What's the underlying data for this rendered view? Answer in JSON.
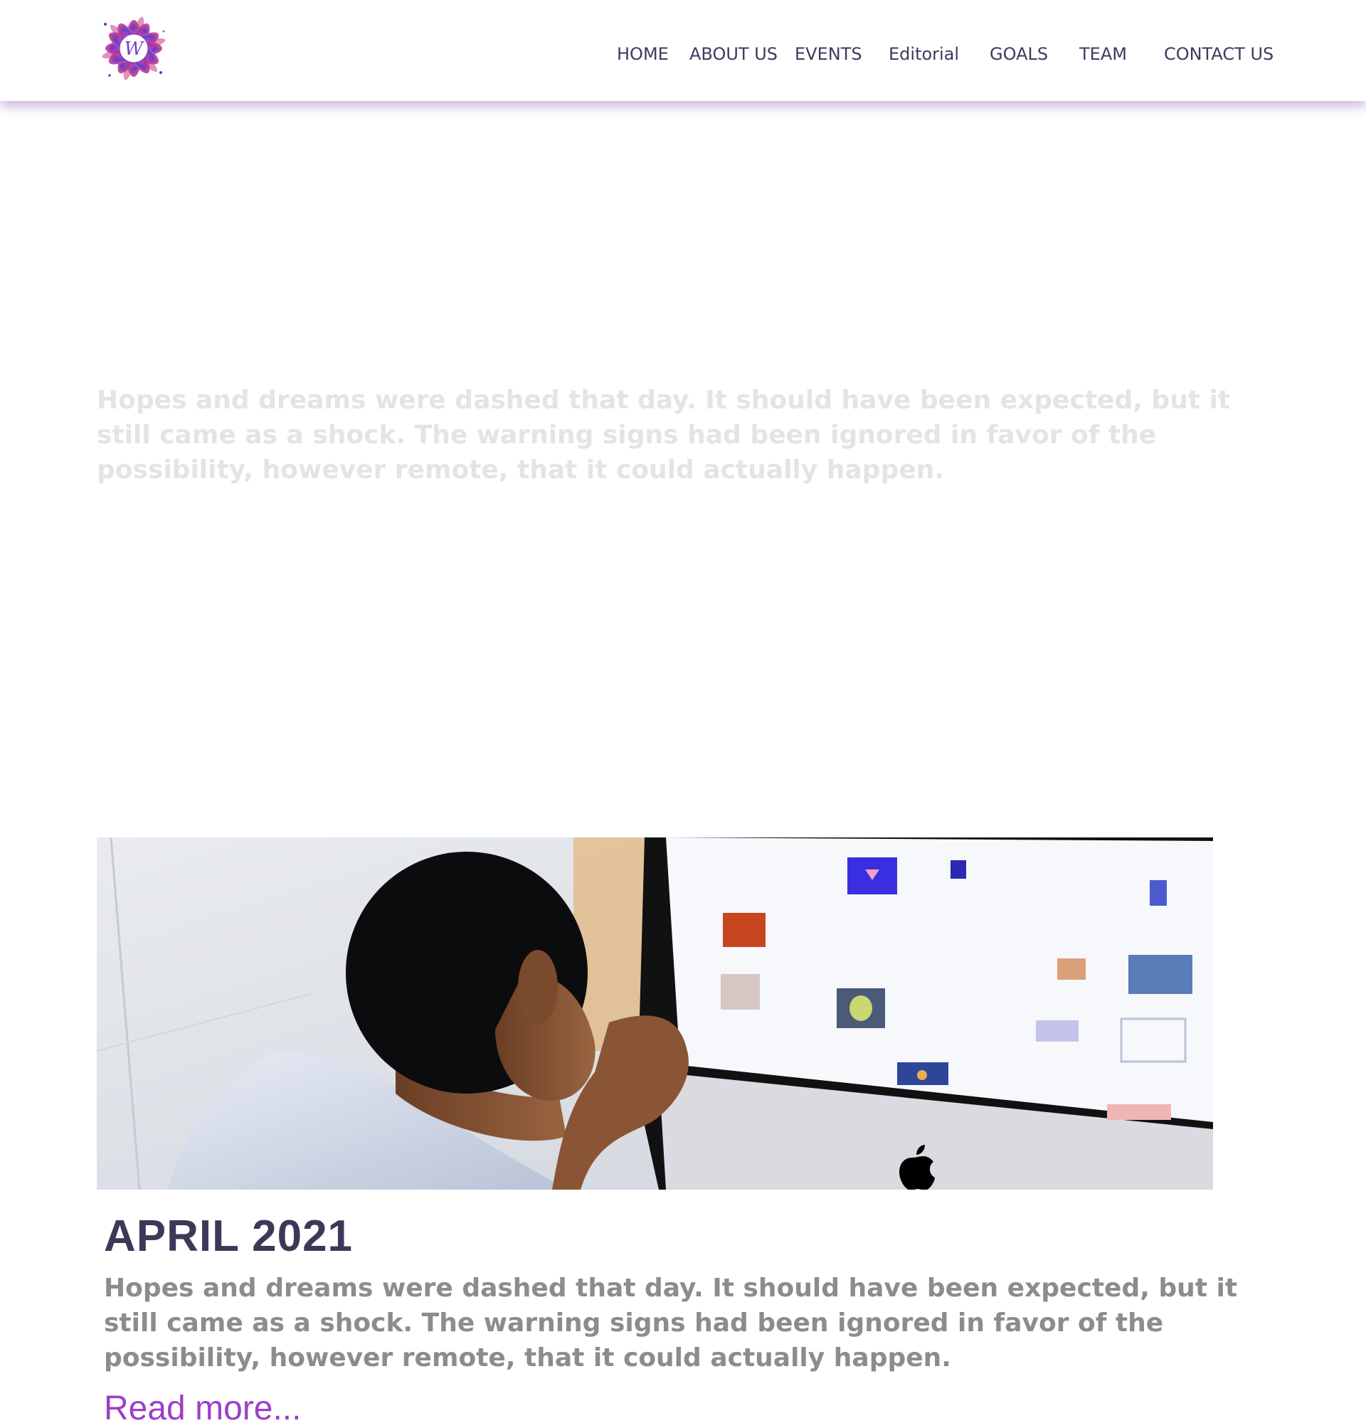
{
  "header": {
    "logo": {
      "icon": "mandala-logo-icon",
      "letter": "W",
      "colors": [
        "#7b2fd0",
        "#d8479a",
        "#4a3fc2"
      ]
    },
    "nav": [
      {
        "label": "HOME"
      },
      {
        "label": "ABOUT US"
      },
      {
        "label": "EVENTS"
      },
      {
        "label": "Editorial"
      },
      {
        "label": "GOALS"
      },
      {
        "label": "TEAM"
      },
      {
        "label": "CONTACT US"
      }
    ]
  },
  "hero": {
    "text": "Hopes and dreams were dashed that day. It should have been expected, but it still came as a shock. The warning signs had been ignored in favor of the possibility, however remote, that it could actually happen."
  },
  "post": {
    "image": "man-at-computer-photo",
    "title": "APRIL 2021",
    "excerpt": "Hopes and dreams were dashed that day. It should have been expected, but it still came as a shock. The warning signs had been ignored in favor of the possibility, however remote, that it could actually happen.",
    "read_more": "Read more..."
  },
  "colors": {
    "nav_text": "#3f3a5e",
    "accent": "#9b3fc7",
    "title": "#3e3858",
    "excerpt": "#8c8c8c",
    "hero_text": "#e4e4e4"
  }
}
